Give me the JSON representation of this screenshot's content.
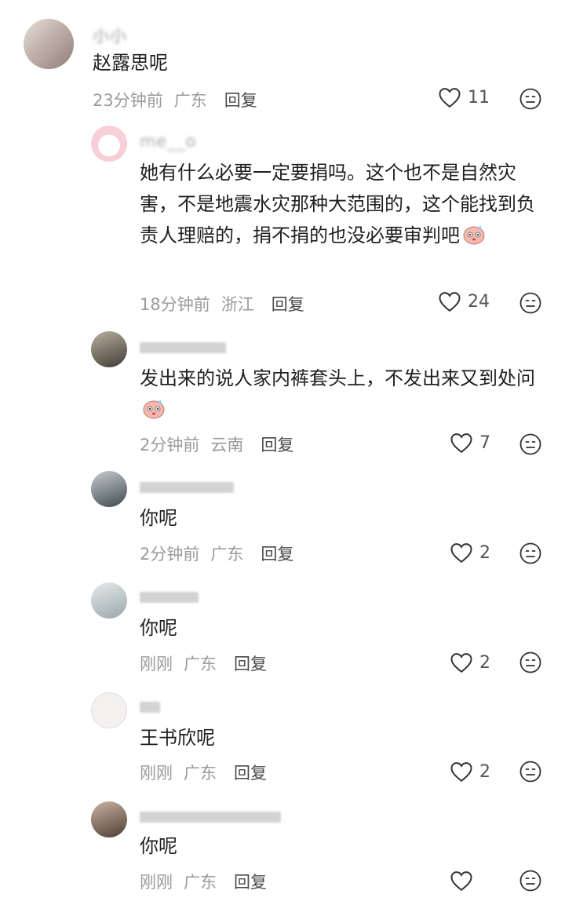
{
  "comments": [
    {
      "username": "小小",
      "text": "赵露思呢",
      "time": "23分钟前",
      "location": "广东",
      "reply_label": "回复",
      "likes": "11",
      "avatar_color": "#c9b7ae"
    },
    {
      "username": "me__o",
      "text": "她有什么必要一定要捐吗。这个也不是自然灾害，不是地震水灾那种大范围的，这个能找到负责人理赔的，捐不捐的也没必要审判吧",
      "time": "18分钟前",
      "location": "浙江",
      "reply_label": "回复",
      "likes": "24",
      "avatar_color": "#f6d9dc"
    },
    {
      "username": "",
      "text": "发出来的说人家内裤套头上，不发出来又到处问",
      "time": "2分钟前",
      "location": "云南",
      "reply_label": "回复",
      "likes": "7",
      "avatar_color": "#6f6a60"
    },
    {
      "username": "",
      "text": "你呢",
      "time": "2分钟前",
      "location": "广东",
      "reply_label": "回复",
      "likes": "2",
      "avatar_color": "#7d8a90"
    },
    {
      "username": "",
      "text": "你呢",
      "time": "刚刚",
      "location": "广东",
      "reply_label": "回复",
      "likes": "2",
      "avatar_color": "#cfd6d8"
    },
    {
      "username": "",
      "text": "王书欣呢",
      "time": "刚刚",
      "location": "广东",
      "reply_label": "回复",
      "likes": "2",
      "avatar_color": "#f1eded"
    },
    {
      "username": "",
      "text": "你呢",
      "time": "刚刚",
      "location": "广东",
      "reply_label": "回复",
      "likes": "",
      "avatar_color": "#8c7566"
    }
  ],
  "icons": {
    "like": "heart-outline-icon",
    "dislike": "meh-face-icon",
    "inline_emoji": "sweat-face-emoji"
  }
}
